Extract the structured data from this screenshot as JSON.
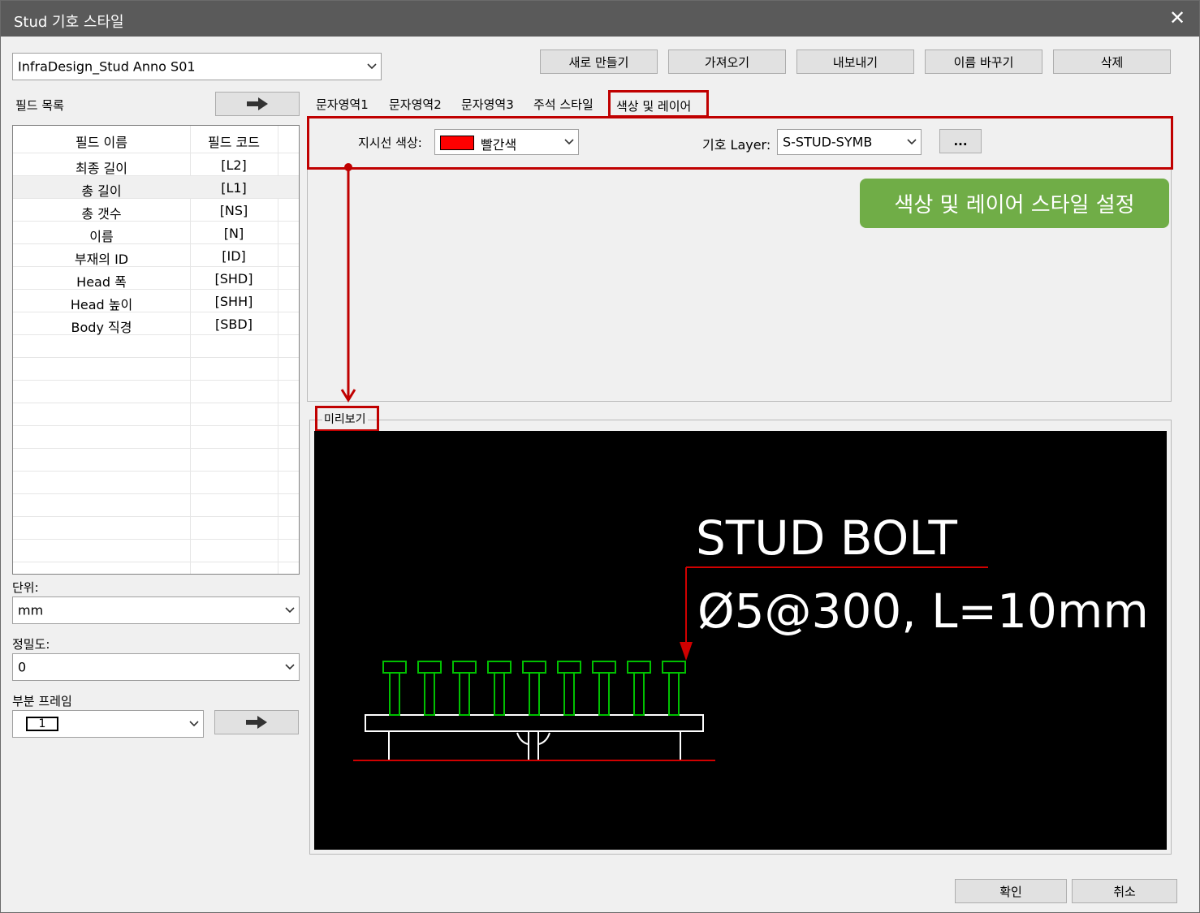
{
  "window": {
    "title": "Stud 기호 스타일",
    "close_glyph": "✕"
  },
  "style_combo": {
    "value": "InfraDesign_Stud Anno S01"
  },
  "toolbar": {
    "new_label": "새로 만들기",
    "import_label": "가져오기",
    "export_label": "내보내기",
    "rename_label": "이름 바꾸기",
    "delete_label": "삭제"
  },
  "field_list": {
    "label": "필드 목록",
    "header_name": "필드 이름",
    "header_code": "필드 코드",
    "rows": [
      {
        "name": "최종 길이",
        "code": "[L2]"
      },
      {
        "name": "총 길이",
        "code": "[L1]"
      },
      {
        "name": "총 갯수",
        "code": "[NS]"
      },
      {
        "name": "이름",
        "code": "[N]"
      },
      {
        "name": "부재의 ID",
        "code": "[ID]"
      },
      {
        "name": "Head 폭",
        "code": "[SHD]"
      },
      {
        "name": "Head 높이",
        "code": "[SHH]"
      },
      {
        "name": "Body 직경",
        "code": "[SBD]"
      }
    ]
  },
  "unit": {
    "label": "단위:",
    "value": "mm"
  },
  "precision": {
    "label": "정밀도:",
    "value": "0"
  },
  "partial_frame": {
    "label": "부분 프레임",
    "value": "1"
  },
  "tabs": [
    {
      "label": "문자영역1"
    },
    {
      "label": "문자영역2"
    },
    {
      "label": "문자영역3"
    },
    {
      "label": "주석 스타일"
    },
    {
      "label": "색상 및 레이어"
    }
  ],
  "settings": {
    "leader_color_label": "지시선 색상:",
    "leader_color_value": "빨간색",
    "leader_color_swatch": "#ff0000",
    "layer_label": "기호 Layer:",
    "layer_value": "S-STUD-SYMB",
    "browse_label": "..."
  },
  "callout": {
    "text": "색상 및 레이어 스타일 설정"
  },
  "preview": {
    "label": "미리보기",
    "title": "STUD BOLT",
    "spec": "Ø5@300, L=10mm",
    "stud_count": 9
  },
  "footer": {
    "ok_label": "확인",
    "cancel_label": "취소"
  },
  "colors": {
    "accent_red": "#c00000",
    "callout_green": "#70ad47",
    "stud_green": "#00c000"
  }
}
